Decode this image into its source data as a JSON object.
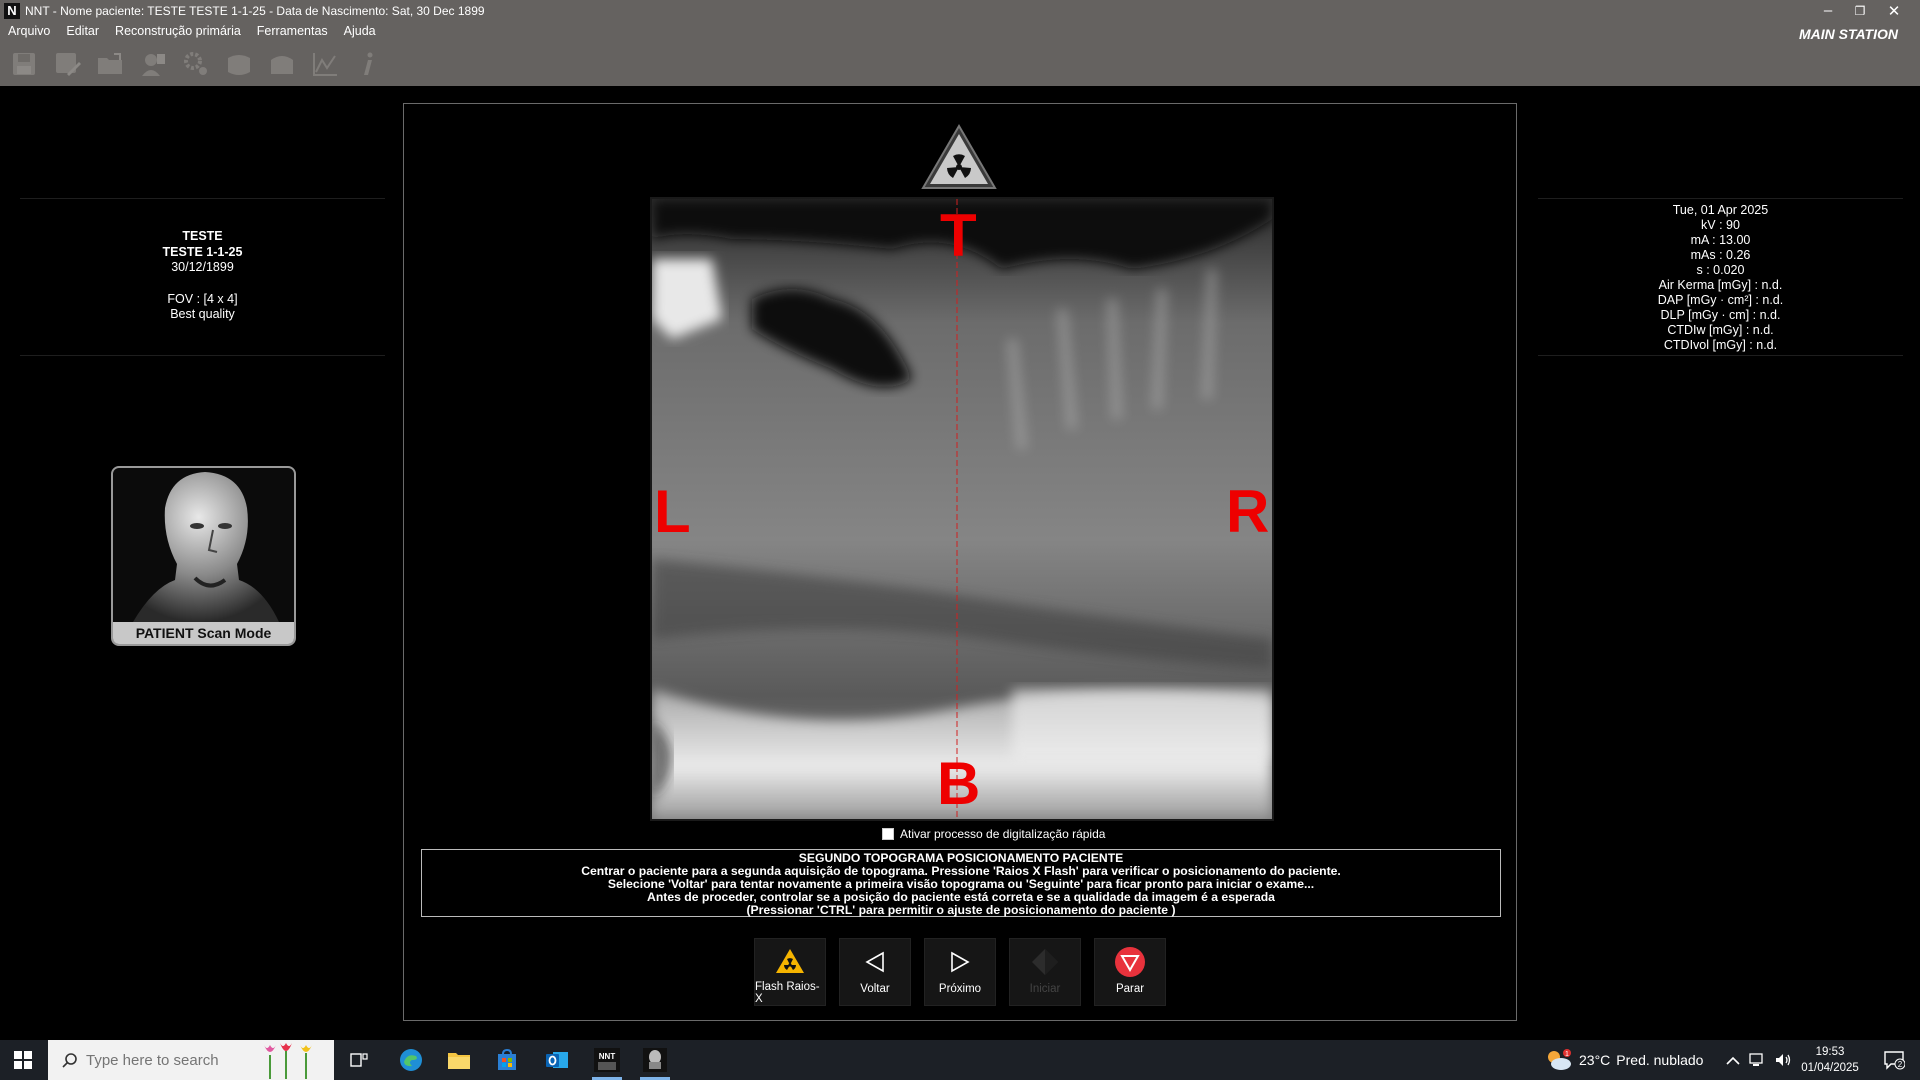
{
  "window": {
    "logo": "N",
    "title": "NNT - Nome paciente: TESTE TESTE 1-1-25 - Data de Nascimento: Sat, 30 Dec 1899",
    "station": "MAIN STATION",
    "minimize": "–",
    "restore": "❐",
    "close": "✕"
  },
  "menu": [
    "Arquivo",
    "Editar",
    "Reconstrução primária",
    "Ferramentas",
    "Ajuda"
  ],
  "toolbar_icons": [
    "save-icon",
    "save-edit-icon",
    "open-folder-icon",
    "patient-icon",
    "settings-icon",
    "scan-3d-icon",
    "scan-arch-icon",
    "graph-icon",
    "info-icon"
  ],
  "patient": {
    "surname": "TESTE",
    "fullname": "TESTE 1-1-25",
    "birthdate": "30/12/1899",
    "fov": "FOV : [4 x 4]",
    "quality": "Best quality"
  },
  "exposure": {
    "date": "Tue, 01 Apr 2025",
    "kv": "kV : 90",
    "ma": "mA : 13.00",
    "mas": "mAs : 0.26",
    "s": "s : 0.020",
    "air_kerma": "Air Kerma [mGy] : n.d.",
    "dap": "DAP [mGy · cm²] : n.d.",
    "dlp": "DLP [mGy · cm] : n.d.",
    "ctdiw": "CTDIw [mGy] : n.d.",
    "ctdivol": "CTDIvol [mGy] : n.d."
  },
  "scan_mode": {
    "label": "PATIENT Scan Mode"
  },
  "orientation": {
    "top": "T",
    "bottom": "B",
    "left": "L",
    "right": "R"
  },
  "quickscan": {
    "label": "Ativar processo de digitalização rápida",
    "checked": false
  },
  "instructions": [
    "SEGUNDO TOPOGRAMA POSICIONAMENTO PACIENTE",
    "Centrar o paciente para a segunda aquisição de topograma. Pressione 'Raios X Flash' para verificar o posicionamento do paciente.",
    "Selecione 'Voltar' para tentar novamente a primeira visão topograma ou 'Seguinte' para ficar pronto para iniciar o exame...",
    "Antes de proceder, controlar se a posição do paciente está correta e se a qualidade da imagem é a esperada",
    "(Pressionar 'CTRL' para permitir o ajuste de posicionamento do paciente )"
  ],
  "actions": {
    "flash": "Flash Raios-X",
    "back": "Voltar",
    "next": "Próximo",
    "start": "Iniciar",
    "stop": "Parar"
  },
  "colors": {
    "orientation_red": "#e00000",
    "stop_red": "#e8323c",
    "warning_yellow": "#f5b400",
    "titlebar": "#656260"
  },
  "taskbar": {
    "search_placeholder": "Type here to search",
    "weather_temp": "23°C",
    "weather_desc": "Pred. nublado",
    "weather_badge": "1",
    "time": "19:53",
    "date": "01/04/2025",
    "notifications": "2",
    "apps": [
      "task-view-icon",
      "edge-icon",
      "file-explorer-icon",
      "store-icon",
      "outlook-icon",
      "nnt-app-icon",
      "newtom-app-icon"
    ]
  }
}
